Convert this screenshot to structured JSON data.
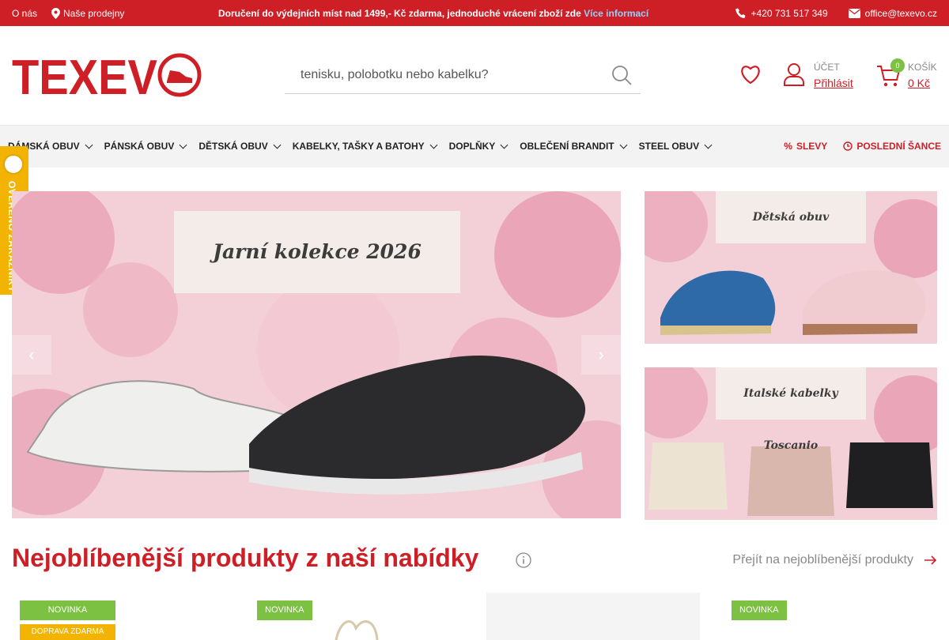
{
  "topbar": {
    "about": "O nás",
    "stores": "Naše prodejny",
    "promo_text": "Doručení do výdejních míst nad 1499,- Kč zdarma, jednoduché vrácení zboží zde",
    "promo_link": "Více informací",
    "phone": "+420 731 517 349",
    "email": "office@texevo.cz"
  },
  "header": {
    "logo_text": "TEXEVO",
    "search_placeholder": "tenisku, polobotku nebo kabelku?",
    "account_label": "ÚČET",
    "login_label": "Přihlásit",
    "cart_label": "KOŠÍK",
    "cart_count": "0",
    "cart_total": "0 Kč"
  },
  "nav": {
    "items": [
      "DÁMSKÁ OBUV",
      "PÁNSKÁ OBUV",
      "DĚTSKÁ OBUV",
      "KABELKY, TAŠKY A BATOHY",
      "DOPLŇKY",
      "OBLEČENÍ BRANDIT",
      "STEEL OBUV"
    ],
    "sales": "SLEVY",
    "last_chance": "POSLEDNÍ ŠANCE"
  },
  "verified_badge": "OVĚŘENO ZÁKAZNÍKY",
  "banners": {
    "hero_title": "Jarní kolekce 2026",
    "side1_title": "Dětská obuv",
    "side2_title": "Italské kabelky Toscanio"
  },
  "section": {
    "title": "Nejoblíbenější produkty z naší nabídky",
    "link": "Přejít na nejoblíbenější produkty"
  },
  "products": [
    {
      "tag": "NOVINKA",
      "tag2": "DOPRAVA ZDARMA"
    },
    {
      "tag": "NOVINKA"
    },
    {
      "tag": ""
    },
    {
      "tag": "NOVINKA"
    }
  ],
  "colors": {
    "brand_red": "#cf1f26",
    "new_green": "#7cc142",
    "badge_yellow": "#f2b400"
  }
}
